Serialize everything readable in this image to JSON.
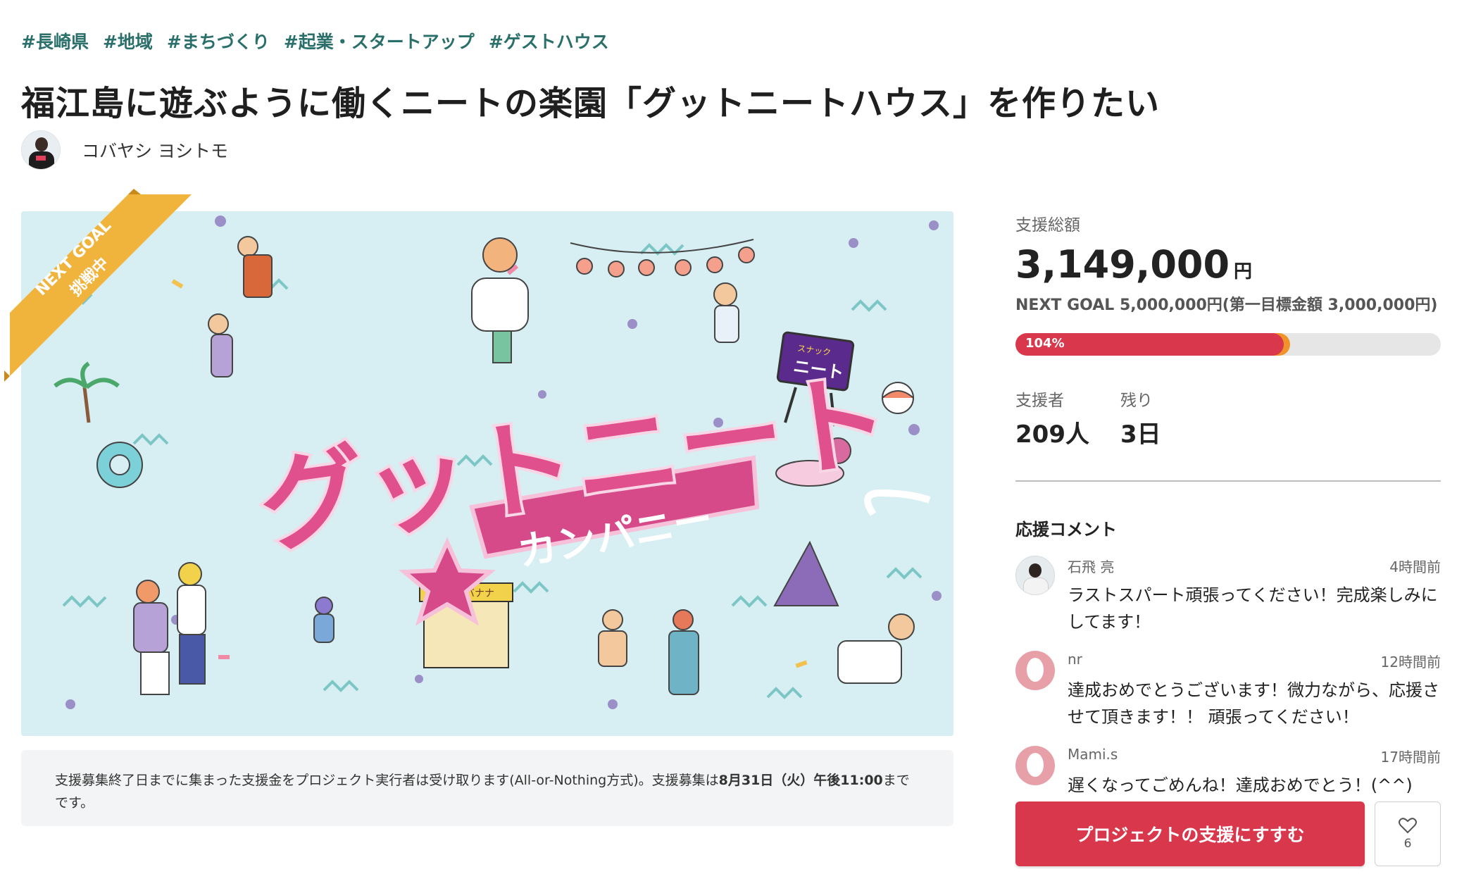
{
  "tags": [
    "#長崎県",
    "#地域",
    "#まちづくり",
    "#起業・スタートアップ",
    "#ゲストハウス"
  ],
  "project": {
    "title": "福江島に遊ぶように働くニートの楽園「グットニートハウス」を作りたい",
    "owner_name": "コバヤシ ヨシトモ"
  },
  "hero": {
    "ribbon_line1": "NEXT GOAL",
    "ribbon_line2": "挑戦中",
    "logo_main": "グットニート",
    "logo_sub": "カンパニー",
    "sign_line1": "スナック",
    "sign_line2": "ニート",
    "stall_sign": "チョコバナナ"
  },
  "notice": {
    "text_before": "支援募集終了日までに集まった支援金をプロジェクト実行者は受け取ります(All-or-Nothing方式)。支援募集は",
    "deadline": "8月31日（火）午後11:00",
    "text_after": "までです。"
  },
  "funding": {
    "total_label": "支援総額",
    "total_amount": "3,149,000",
    "currency": "円",
    "next_goal_text": "NEXT GOAL 5,000,000円(第一目標金額 3,000,000円)",
    "progress_label": "104%",
    "progress_fraction": 0.63,
    "supporters_label": "支援者",
    "supporters_value": "209人",
    "remaining_label": "残り",
    "remaining_value": "3日"
  },
  "comments": {
    "heading": "応援コメント",
    "items": [
      {
        "name": "石飛 亮",
        "time": "4時間前",
        "text": "ラストスパート頑張ってください！完成楽しみにしてます！"
      },
      {
        "name": "nr",
        "time": "12時間前",
        "text": "達成おめでとうございます！微力ながら、応援させて頂きます！！ 頑張ってください！"
      },
      {
        "name": "Mami.s",
        "time": "17時間前",
        "text": "遅くなってごめんね！達成おめでとう！(^^)"
      }
    ]
  },
  "actions": {
    "support_label": "プロジェクトの支援にすすむ",
    "favorite_count": "6"
  },
  "colors": {
    "accent": "#d9374b",
    "tag": "#2a6f6a",
    "ribbon": "#f0b43c",
    "logo_pink": "#e0508c"
  }
}
